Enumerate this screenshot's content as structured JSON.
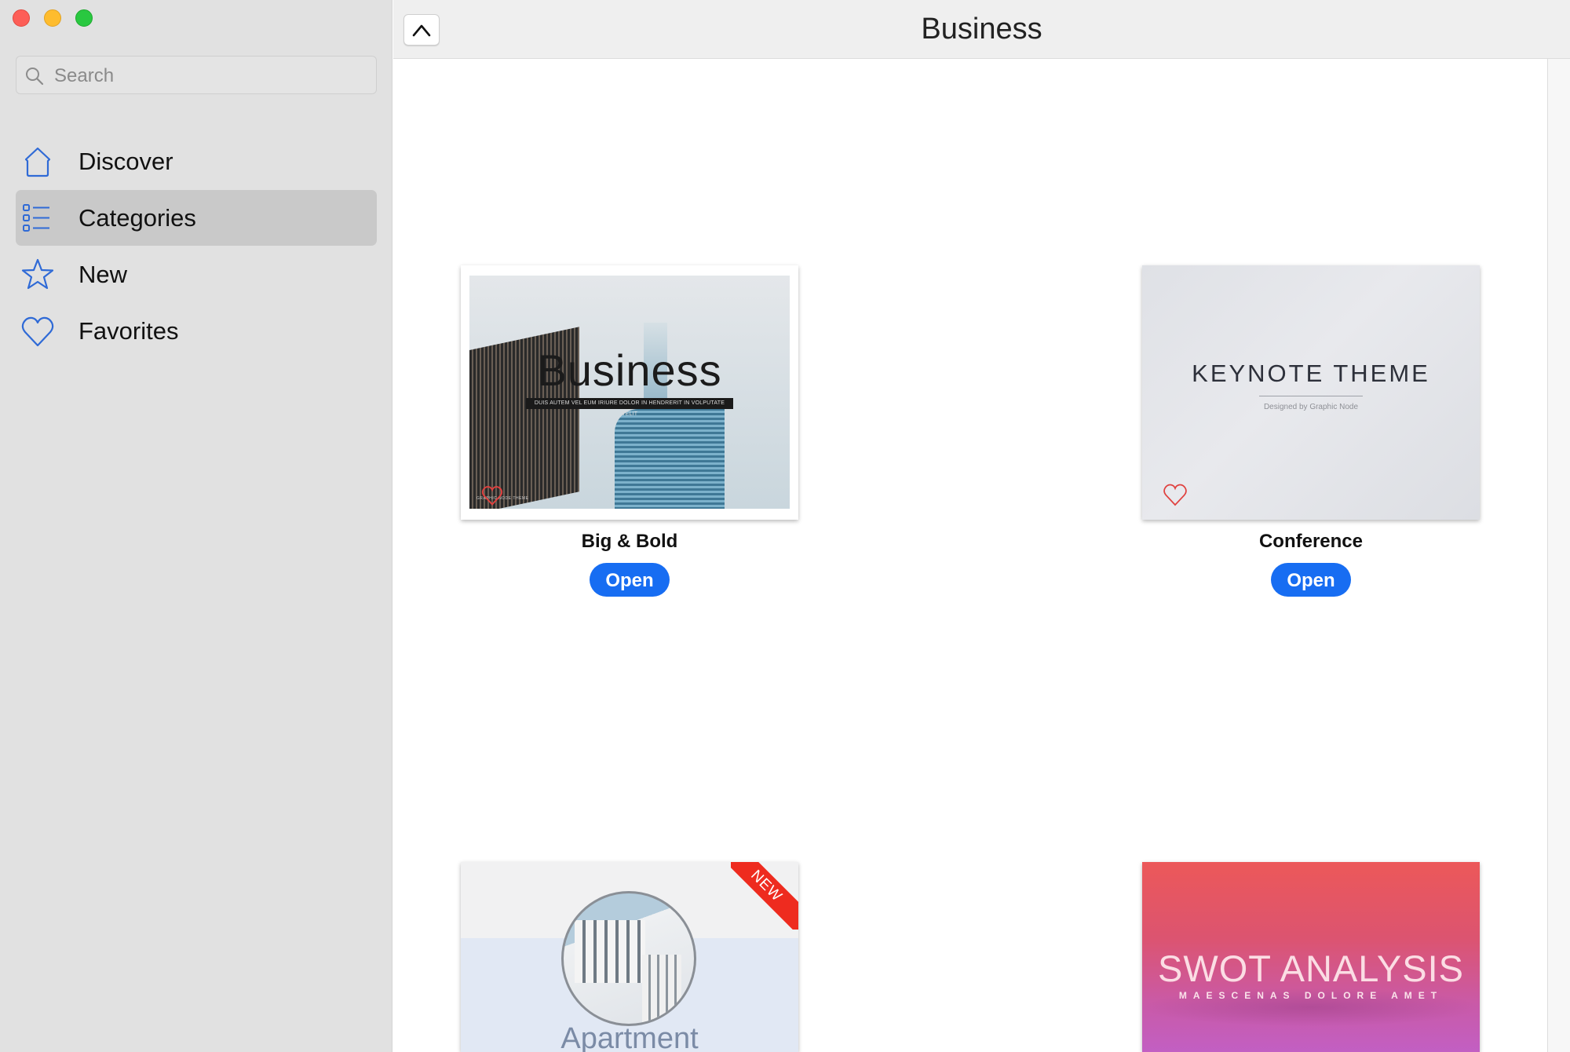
{
  "window": {
    "controls": [
      "close",
      "minimize",
      "maximize"
    ]
  },
  "sidebar": {
    "search": {
      "placeholder": "Search",
      "value": ""
    },
    "items": [
      {
        "label": "Discover",
        "icon": "house-icon",
        "active": false
      },
      {
        "label": "Categories",
        "icon": "list-icon",
        "active": true
      },
      {
        "label": "New",
        "icon": "star-icon",
        "active": false
      },
      {
        "label": "Favorites",
        "icon": "heart-icon",
        "active": false
      }
    ],
    "accent_color": "#2f6ad6"
  },
  "header": {
    "title": "Business",
    "back_button_icon": "chevron-up-icon"
  },
  "templates": [
    {
      "name": "Big & Bold",
      "open_label": "Open",
      "thumb": {
        "headline": "Business",
        "subline": "DUIS AUTEM VEL EUM IRIURE DOLOR IN HENDRERIT IN VOLPUTATE VELIT",
        "footer": "GRAPHIC NODE THEME"
      },
      "favorite": false
    },
    {
      "name": "Conference",
      "open_label": "Open",
      "thumb": {
        "headline": "KEYNOTE THEME",
        "subline": "Designed by Graphic Node"
      },
      "favorite": false
    },
    {
      "name": "Apartment",
      "thumb": {
        "headline": "Apartment",
        "badge": "NEW"
      }
    },
    {
      "name": "SWOT Analysis",
      "thumb": {
        "headline": "SWOT ANALYSIS",
        "subline": "MAESCENAS DOLORE AMET"
      }
    }
  ],
  "colors": {
    "open_button": "#176df2",
    "favorite_heart": "#e0413f",
    "new_badge": "#ee2b1f"
  }
}
